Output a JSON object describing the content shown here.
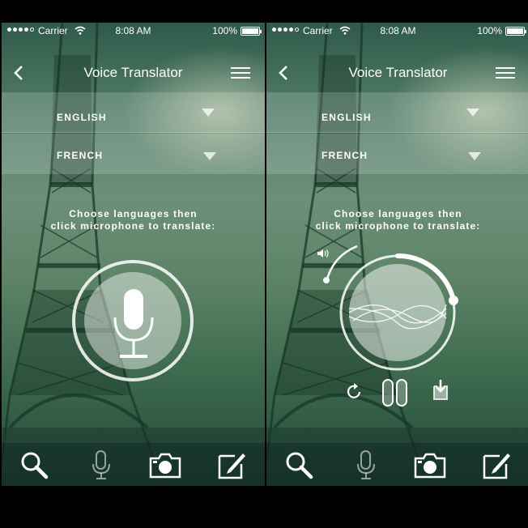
{
  "status_bar": {
    "carrier": "Carrier",
    "time": "8:08 AM",
    "battery": "100%",
    "signal_bars_filled": 4,
    "signal_bars_total": 5
  },
  "nav": {
    "title": "Voice Translator",
    "back_icon": "chevron-left-icon",
    "menu_icon": "hamburger-menu-icon"
  },
  "languages": {
    "source": "ENGLISH",
    "target": "FRENCH"
  },
  "instruction": {
    "line1": "Choose languages then",
    "line2": "click microphone to translate:"
  },
  "screens": [
    {
      "state": "idle",
      "center_icon": "microphone-icon"
    },
    {
      "state": "recording",
      "center_icon": "sound-wave-icon",
      "controls": [
        "replay-icon",
        "pause-icon",
        "save-download-icon"
      ]
    }
  ],
  "tab_bar": {
    "items": [
      "search-icon",
      "microphone-icon",
      "camera-icon",
      "compose-icon"
    ]
  },
  "colors": {
    "accent": "#ffffff",
    "overlay": "#ffffff2b",
    "background_top": "#2f5a4a",
    "background_bottom": "#22493a"
  }
}
